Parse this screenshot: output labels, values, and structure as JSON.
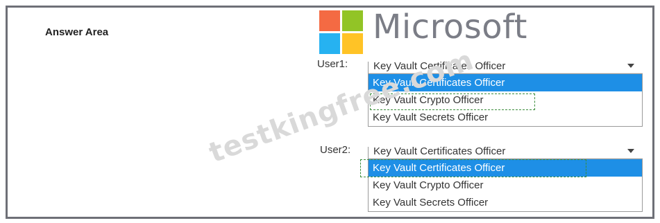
{
  "answer_area": {
    "title": "Answer Area"
  },
  "logo": {
    "text": "Microsoft",
    "colors": [
      "#f25022",
      "#7fba00",
      "#00a4ef",
      "#ffb900"
    ]
  },
  "watermark": {
    "text": "testkingfree.com"
  },
  "user1": {
    "label": "User1:",
    "selected_value": "Key Vault Certificates Officer",
    "options": [
      "Key Vault Certificates Officer",
      "Key Vault Crypto Officer",
      "Key Vault Secrets Officer"
    ],
    "highlighted_index": 0
  },
  "user2": {
    "label": "User2:",
    "selected_value": "Key Vault Certificates Officer",
    "options": [
      "Key Vault Certificates Officer",
      "Key Vault Crypto Officer",
      "Key Vault Secrets Officer"
    ],
    "highlighted_index": 0
  },
  "colors": {
    "highlight": "#1e8fe6",
    "frame": "#6e7077",
    "answer_box": "#3a8c3a"
  }
}
